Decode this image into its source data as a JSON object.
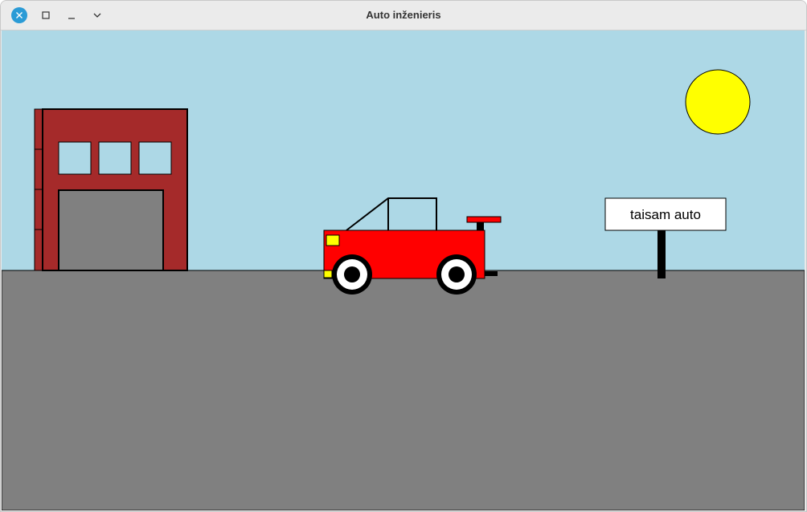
{
  "window": {
    "title": "Auto inženieris",
    "controls": [
      "close-icon",
      "maximize-icon",
      "minimize-icon",
      "menu-chevron-icon"
    ],
    "colors": {
      "accent": "#2a9bd6"
    }
  },
  "scene": {
    "sign_text": "taisam auto",
    "colors": {
      "sky": "#add8e6",
      "ground": "#808080",
      "sun": "#ffff00",
      "building": "#a52a2a",
      "door": "#808080",
      "car": "#ff0000",
      "headlight": "#ffff00",
      "spoiler": "#ff0000",
      "wheel_outer": "#000000",
      "wheel_inner": "#ffffff",
      "sign": "#ffffff"
    }
  }
}
